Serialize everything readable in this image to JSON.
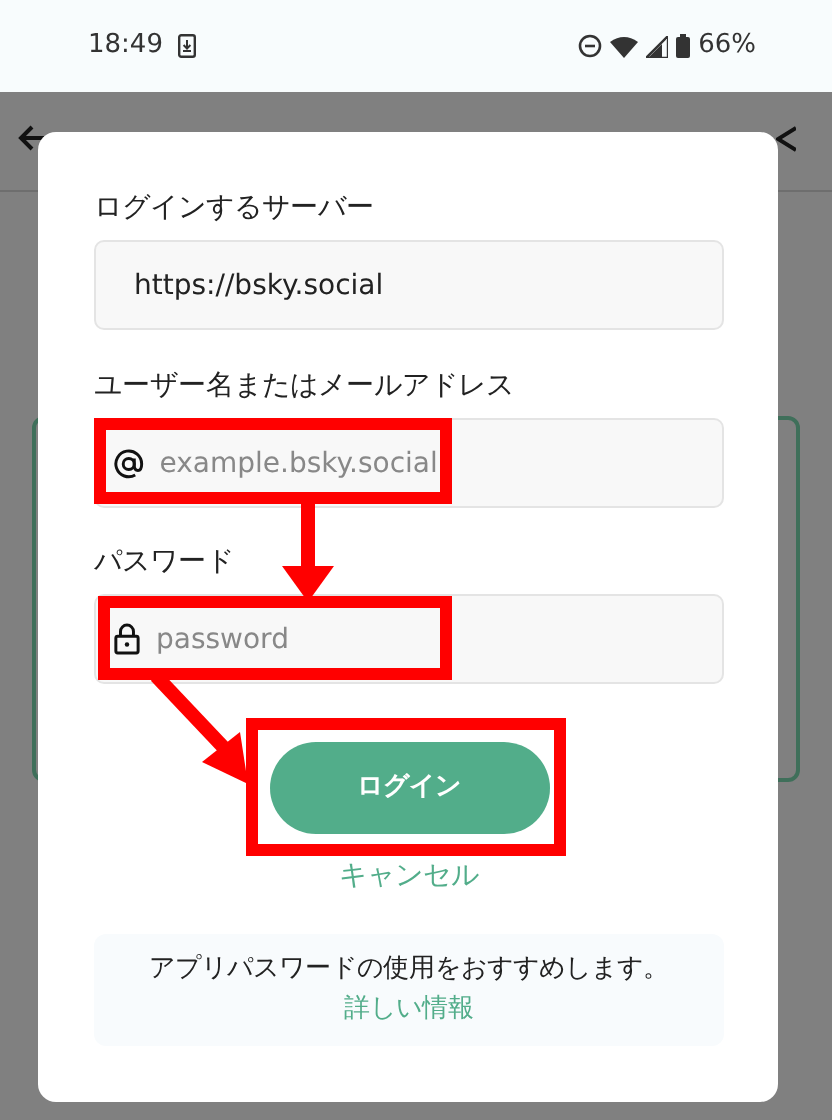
{
  "status_bar": {
    "time": "18:49",
    "battery": "66%"
  },
  "dialog": {
    "fields": [
      {
        "label": "ログインするサーバー",
        "kind": "text",
        "value": "https://bsky.social"
      },
      {
        "label": "ユーザー名またはメールアドレス",
        "kind": "user",
        "placeholder": "example.bsky.social"
      },
      {
        "label": "パスワード",
        "kind": "password",
        "placeholder": "password"
      }
    ],
    "login_button": "ログイン",
    "cancel_link": "キャンセル",
    "notice": {
      "text": "アプリパスワードの使用をおすすめします。",
      "link": "詳しい情報"
    }
  }
}
